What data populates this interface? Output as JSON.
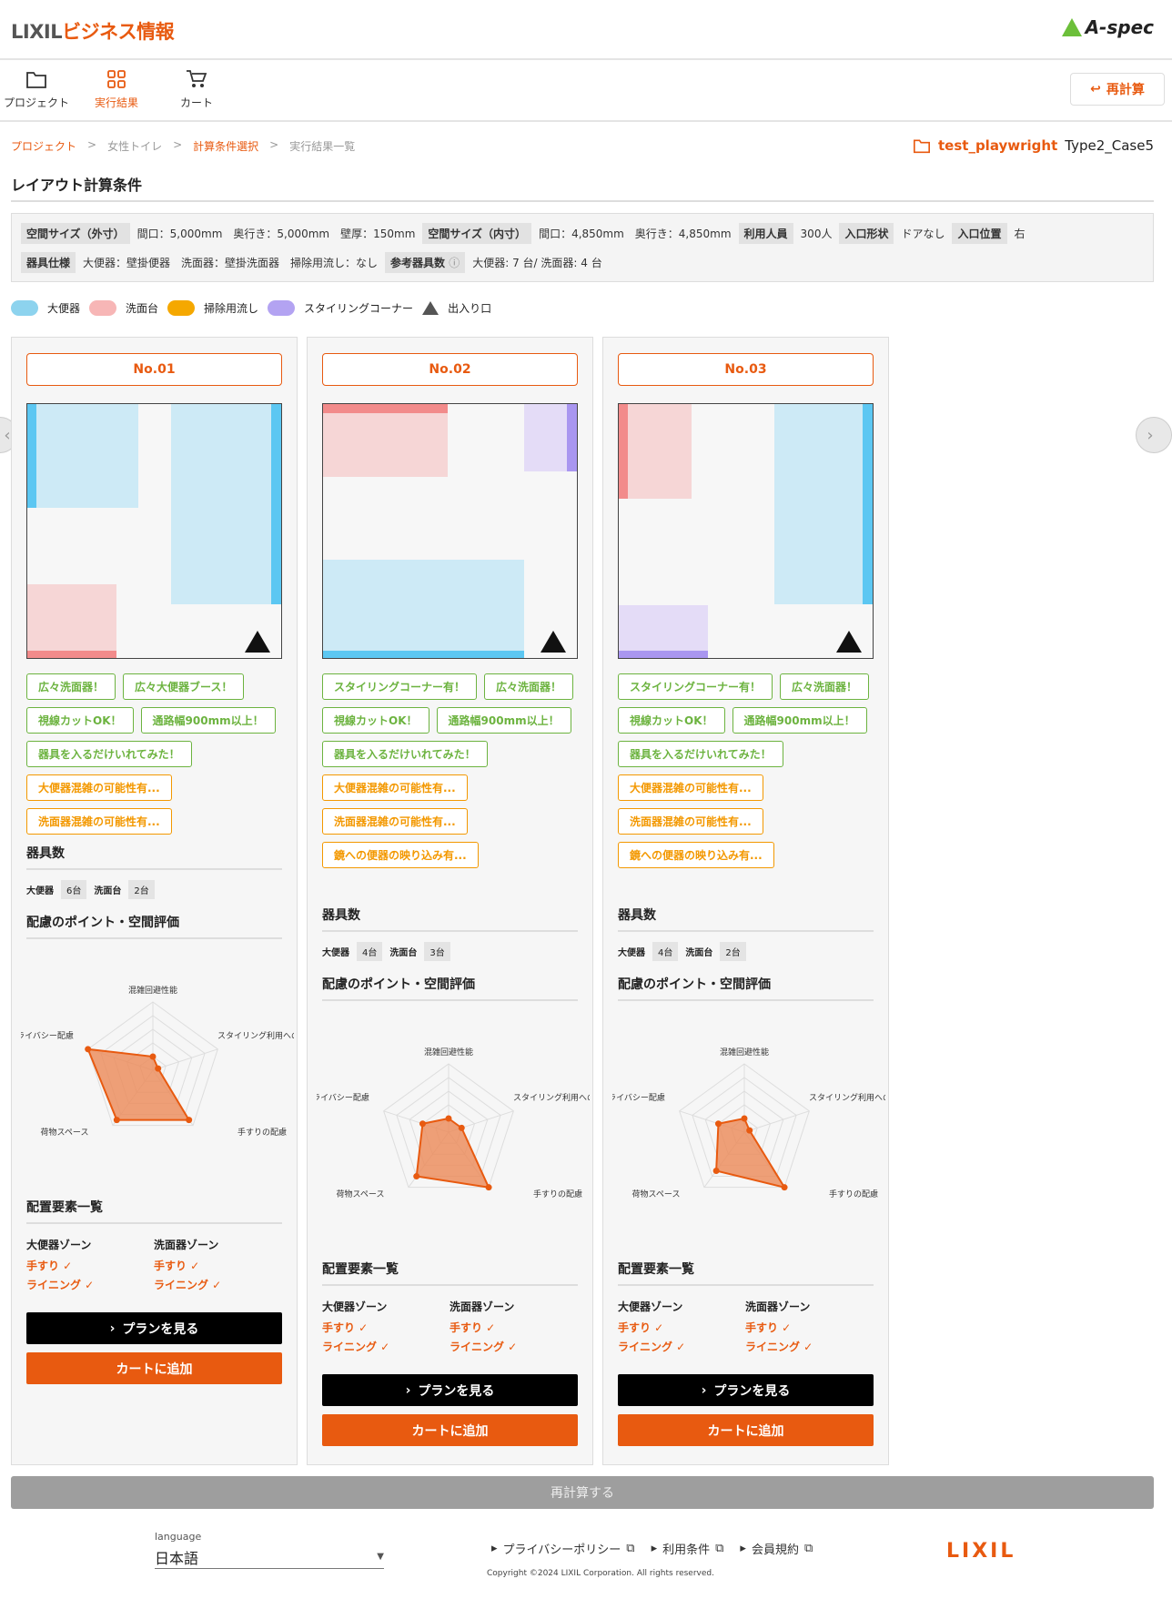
{
  "header": {
    "logo_a": "LIXIL",
    "logo_b": "ビジネス情報",
    "aspec": "A-spec"
  },
  "nav": {
    "items": [
      {
        "label": "プロジェクト"
      },
      {
        "label": "実行結果"
      },
      {
        "label": "カート"
      }
    ],
    "recalc_label": "再計算"
  },
  "breadcrumb": [
    "プロジェクト",
    ">",
    "女性トイレ",
    ">",
    "計算条件選択",
    ">",
    "実行結果一覧"
  ],
  "project": {
    "name": "test_playwright",
    "case": "Type2_Case5"
  },
  "section_title": "レイアウト計算条件",
  "conditions": {
    "row1": [
      {
        "tag": "空間サイズ（外寸）",
        "text": "間口：5,000mm　奥行き：5,000mm　壁厚：150mm"
      },
      {
        "tag": "空間サイズ（内寸）",
        "text": "間口：4,850mm　奥行き：4,850mm"
      },
      {
        "tag": "利用人員",
        "text": "300人"
      },
      {
        "tag": "入口形状",
        "text": "ドアなし"
      },
      {
        "tag": "入口位置",
        "text": "右"
      }
    ],
    "row2": [
      {
        "tag": "器具仕様",
        "text": "大便器：壁掛便器　洗面器：壁掛洗面器　掃除用流し：なし"
      },
      {
        "tag": "参考器具数",
        "text": "大便器: 7 台/ 洗面器: 4 台"
      }
    ]
  },
  "legend": [
    {
      "label": "大便器",
      "color": "#8dd3ee"
    },
    {
      "label": "洗面台",
      "color": "#f7b6b6"
    },
    {
      "label": "掃除用流し",
      "color": "#f5a800"
    },
    {
      "label": "スタイリングコーナー",
      "color": "#b3a3f2"
    },
    {
      "label": "出入り口",
      "color": "#555555"
    }
  ],
  "radar_axes": [
    "混雑回避性能",
    "スタイリング利用への配慮",
    "手すりの配慮",
    "荷物スペース",
    "プライバシー配慮"
  ],
  "cards": [
    {
      "no": "No.01",
      "chips": [
        {
          "t": "広々洗面器！",
          "c": "g"
        },
        {
          "t": "広々大便器ブース！",
          "c": "g"
        },
        {
          "t": "視線カットOK！",
          "c": "g"
        },
        {
          "t": "通路幅900mm以上！",
          "c": "g"
        },
        {
          "t": "器具を入るだけいれてみた！",
          "c": "g"
        },
        {
          "t": "大便器混雑の可能性有...",
          "c": "o"
        },
        {
          "t": "洗面器混雑の可能性有...",
          "c": "o"
        }
      ],
      "count_title": "器具数",
      "counts": [
        {
          "k": "大便器",
          "v": "6台"
        },
        {
          "k": "洗面台",
          "v": "2台"
        }
      ],
      "eval_title": "配慮のポイント・空間評価",
      "radar": [
        0.2,
        0.0,
        0.9,
        0.9,
        1.0
      ],
      "zones_title": "配置要素一覧",
      "zones": [
        {
          "h": "大便器ゾーン",
          "items": [
            "手すり ✓",
            "ライニング ✓"
          ]
        },
        {
          "h": "洗面器ゾーン",
          "items": [
            "手すり ✓",
            "ライニング ✓"
          ]
        }
      ],
      "plan_btn": "プランを見る",
      "cart_btn": "カートに追加"
    },
    {
      "no": "No.02",
      "chips": [
        {
          "t": "スタイリングコーナー有！",
          "c": "g"
        },
        {
          "t": "広々洗面器！",
          "c": "g"
        },
        {
          "t": "視線カットOK！",
          "c": "g"
        },
        {
          "t": "通路幅900mm以上！",
          "c": "g"
        },
        {
          "t": "器具を入るだけいれてみた！",
          "c": "g"
        },
        {
          "t": "大便器混雑の可能性有...",
          "c": "o"
        },
        {
          "t": "洗面器混雑の可能性有...",
          "c": "o"
        },
        {
          "t": "鏡への便器の映り込み有...",
          "c": "o"
        }
      ],
      "count_title": "器具数",
      "counts": [
        {
          "k": "大便器",
          "v": "4台"
        },
        {
          "k": "洗面台",
          "v": "3台"
        }
      ],
      "eval_title": "配慮のポイント・空間評価",
      "radar": [
        0.2,
        0.2,
        1.0,
        0.8,
        0.4
      ],
      "zones_title": "配置要素一覧",
      "zones": [
        {
          "h": "大便器ゾーン",
          "items": [
            "手すり ✓",
            "ライニング ✓"
          ]
        },
        {
          "h": "洗面器ゾーン",
          "items": [
            "手すり ✓",
            "ライニング ✓"
          ]
        }
      ],
      "plan_btn": "プランを見る",
      "cart_btn": "カートに追加"
    },
    {
      "no": "No.03",
      "chips": [
        {
          "t": "スタイリングコーナー有！",
          "c": "g"
        },
        {
          "t": "広々洗面器！",
          "c": "g"
        },
        {
          "t": "視線カットOK！",
          "c": "g"
        },
        {
          "t": "通路幅900mm以上！",
          "c": "g"
        },
        {
          "t": "器具を入るだけいれてみた！",
          "c": "g"
        },
        {
          "t": "大便器混雑の可能性有...",
          "c": "o"
        },
        {
          "t": "洗面器混雑の可能性有...",
          "c": "o"
        },
        {
          "t": "鏡への便器の映り込み有...",
          "c": "o"
        }
      ],
      "count_title": "器具数",
      "counts": [
        {
          "k": "大便器",
          "v": "4台"
        },
        {
          "k": "洗面台",
          "v": "2台"
        }
      ],
      "eval_title": "配慮のポイント・空間評価",
      "radar": [
        0.2,
        0.0,
        1.0,
        0.7,
        0.4
      ],
      "zones_title": "配置要素一覧",
      "zones": [
        {
          "h": "大便器ゾーン",
          "items": [
            "手すり ✓",
            "ライニング ✓"
          ]
        },
        {
          "h": "洗面器ゾーン",
          "items": [
            "手すり ✓",
            "ライニング ✓"
          ]
        }
      ],
      "plan_btn": "プランを見る",
      "cart_btn": "カートに追加"
    }
  ],
  "recalc_bottom": "再計算する",
  "footer": {
    "lang_label": "language",
    "lang_value": "日本語",
    "links": [
      "プライバシーポリシー",
      "利用条件",
      "会員規約"
    ],
    "copyright": "Copyright ©2024 LIXIL Corporation. All rights reserved.",
    "logo": "LIXIL"
  }
}
